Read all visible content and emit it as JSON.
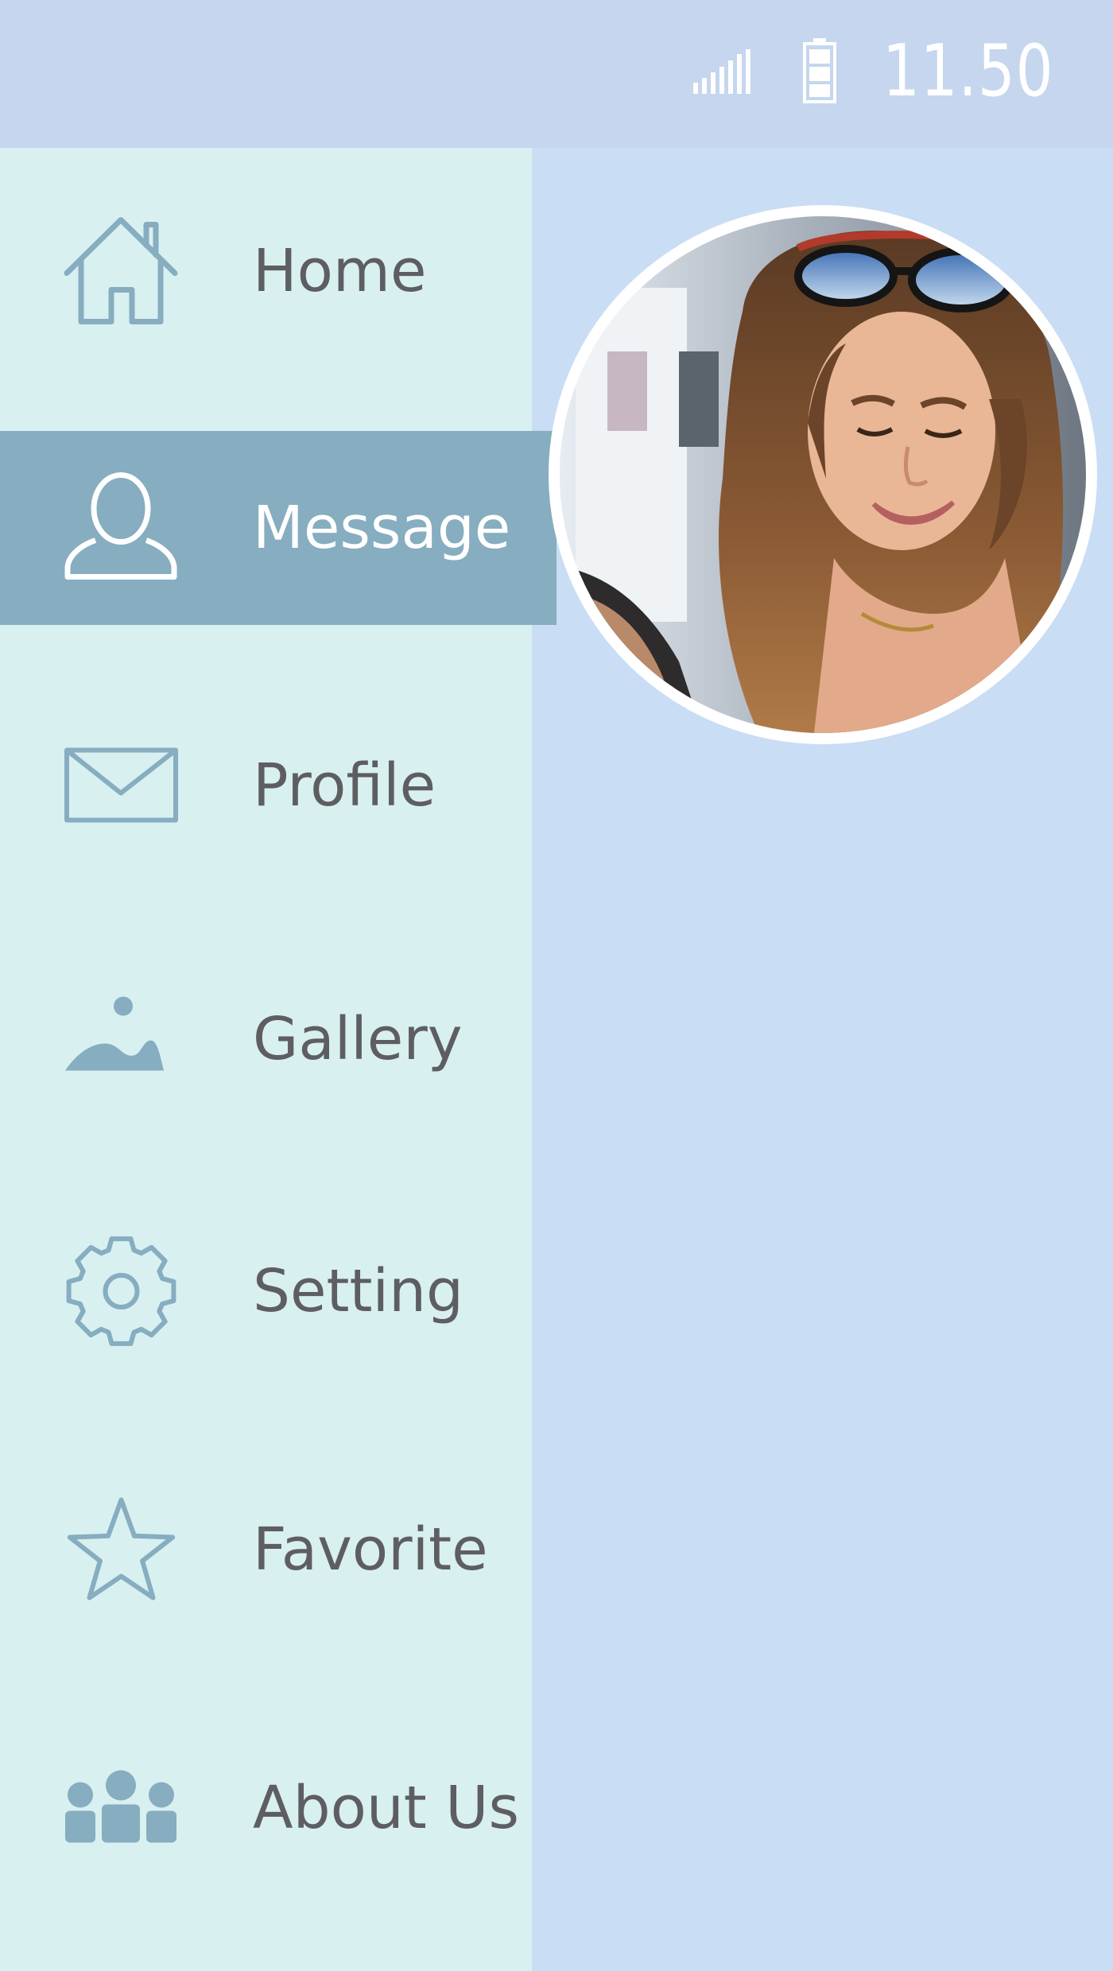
{
  "status_bar": {
    "time": "11.50",
    "signal_icon": "signal-bars-icon",
    "battery_icon": "battery-icon"
  },
  "drawer": {
    "items": [
      {
        "label": "Home",
        "icon": "home-icon",
        "active": false
      },
      {
        "label": "Message",
        "icon": "user-icon",
        "active": true
      },
      {
        "label": "Profile",
        "icon": "envelope-icon",
        "active": false
      },
      {
        "label": "Gallery",
        "icon": "landscape-icon",
        "active": false
      },
      {
        "label": "Setting",
        "icon": "gear-icon",
        "active": false
      },
      {
        "label": "Favorite",
        "icon": "star-icon",
        "active": false
      },
      {
        "label": "About Us",
        "icon": "group-icon",
        "active": false
      }
    ]
  },
  "profile": {
    "avatar": "profile-photo"
  },
  "colors": {
    "status_bar": "#c5d6ee",
    "drawer_bg": "#d8f0f0",
    "content_bg": "#c9ddf5",
    "active_item": "#86adc0",
    "icon": "#86adc0",
    "label_text": "#5e5e62"
  }
}
